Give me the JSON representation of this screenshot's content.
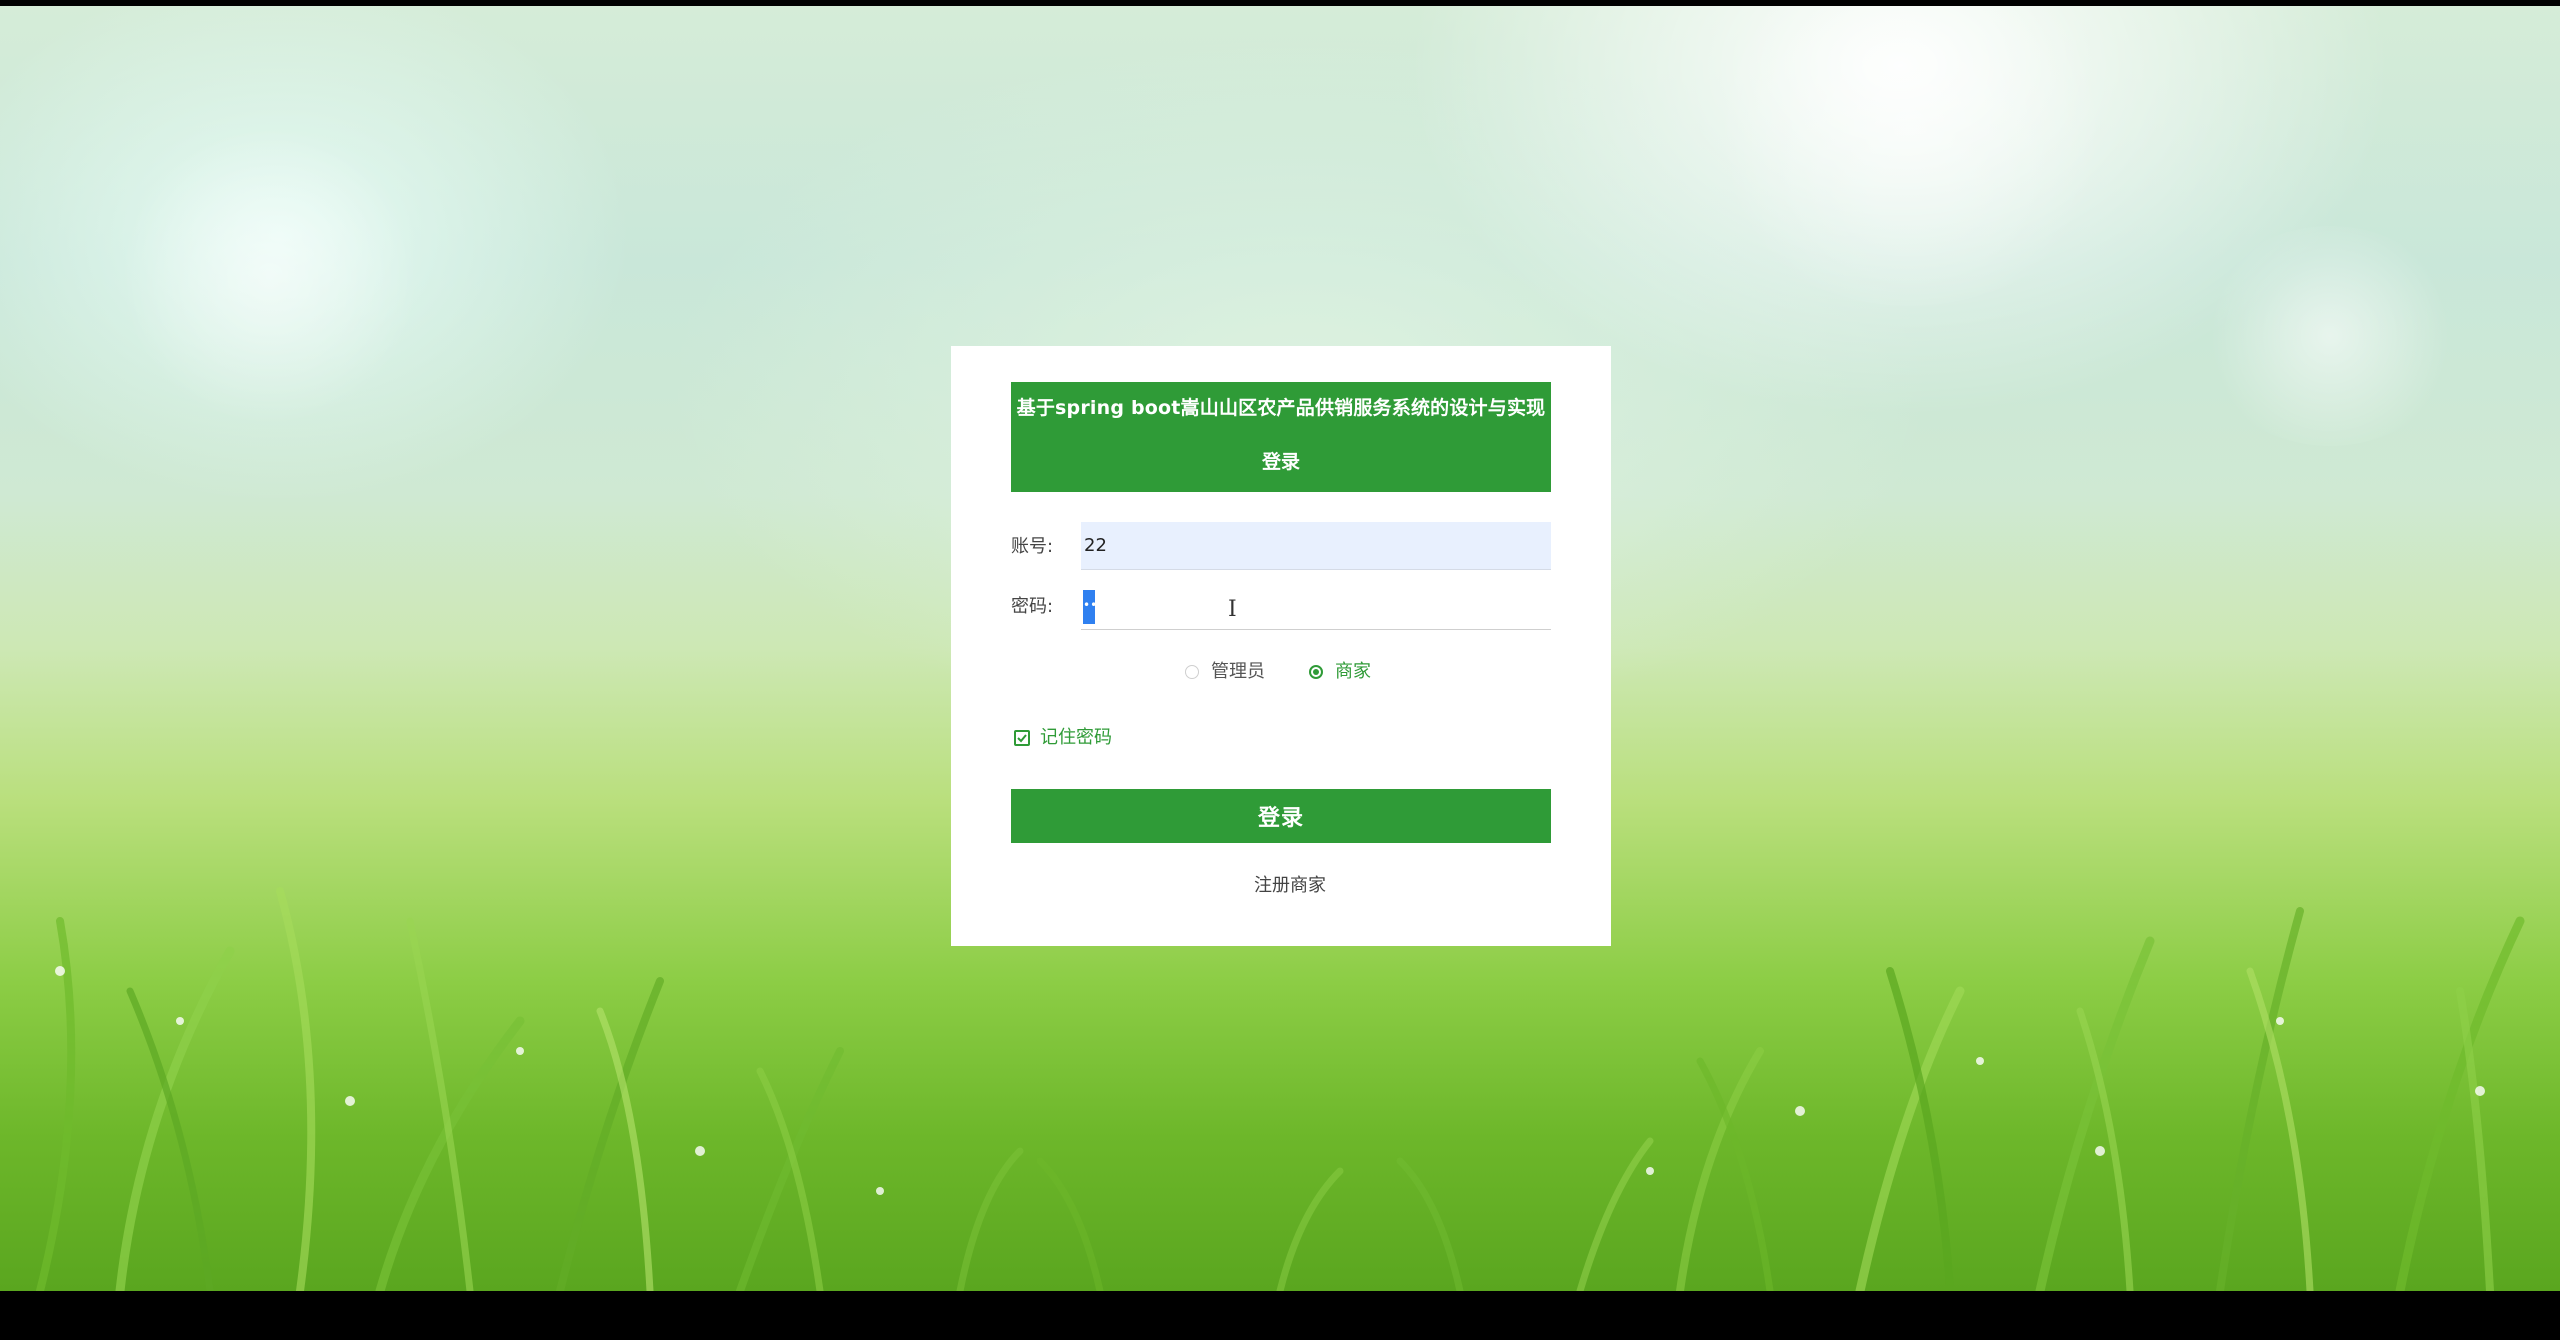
{
  "page": {
    "system_title": "基于spring boot嵩山山区农产品供销服务系统的设计与实现",
    "login_subtitle": "登录"
  },
  "form": {
    "account_label": "账号:",
    "account_value": "22",
    "password_label": "密码:",
    "password_value": "••"
  },
  "roles": {
    "options": [
      {
        "label": "管理员",
        "selected": false
      },
      {
        "label": "商家",
        "selected": true
      }
    ]
  },
  "remember": {
    "label": "记住密码",
    "checked": true
  },
  "actions": {
    "login_label": "登录",
    "register_label": "注册商家"
  },
  "colors": {
    "brand_green": "#2f9b37",
    "autofill_blue": "#e8f0fe",
    "selection_blue": "#2f80f0"
  }
}
